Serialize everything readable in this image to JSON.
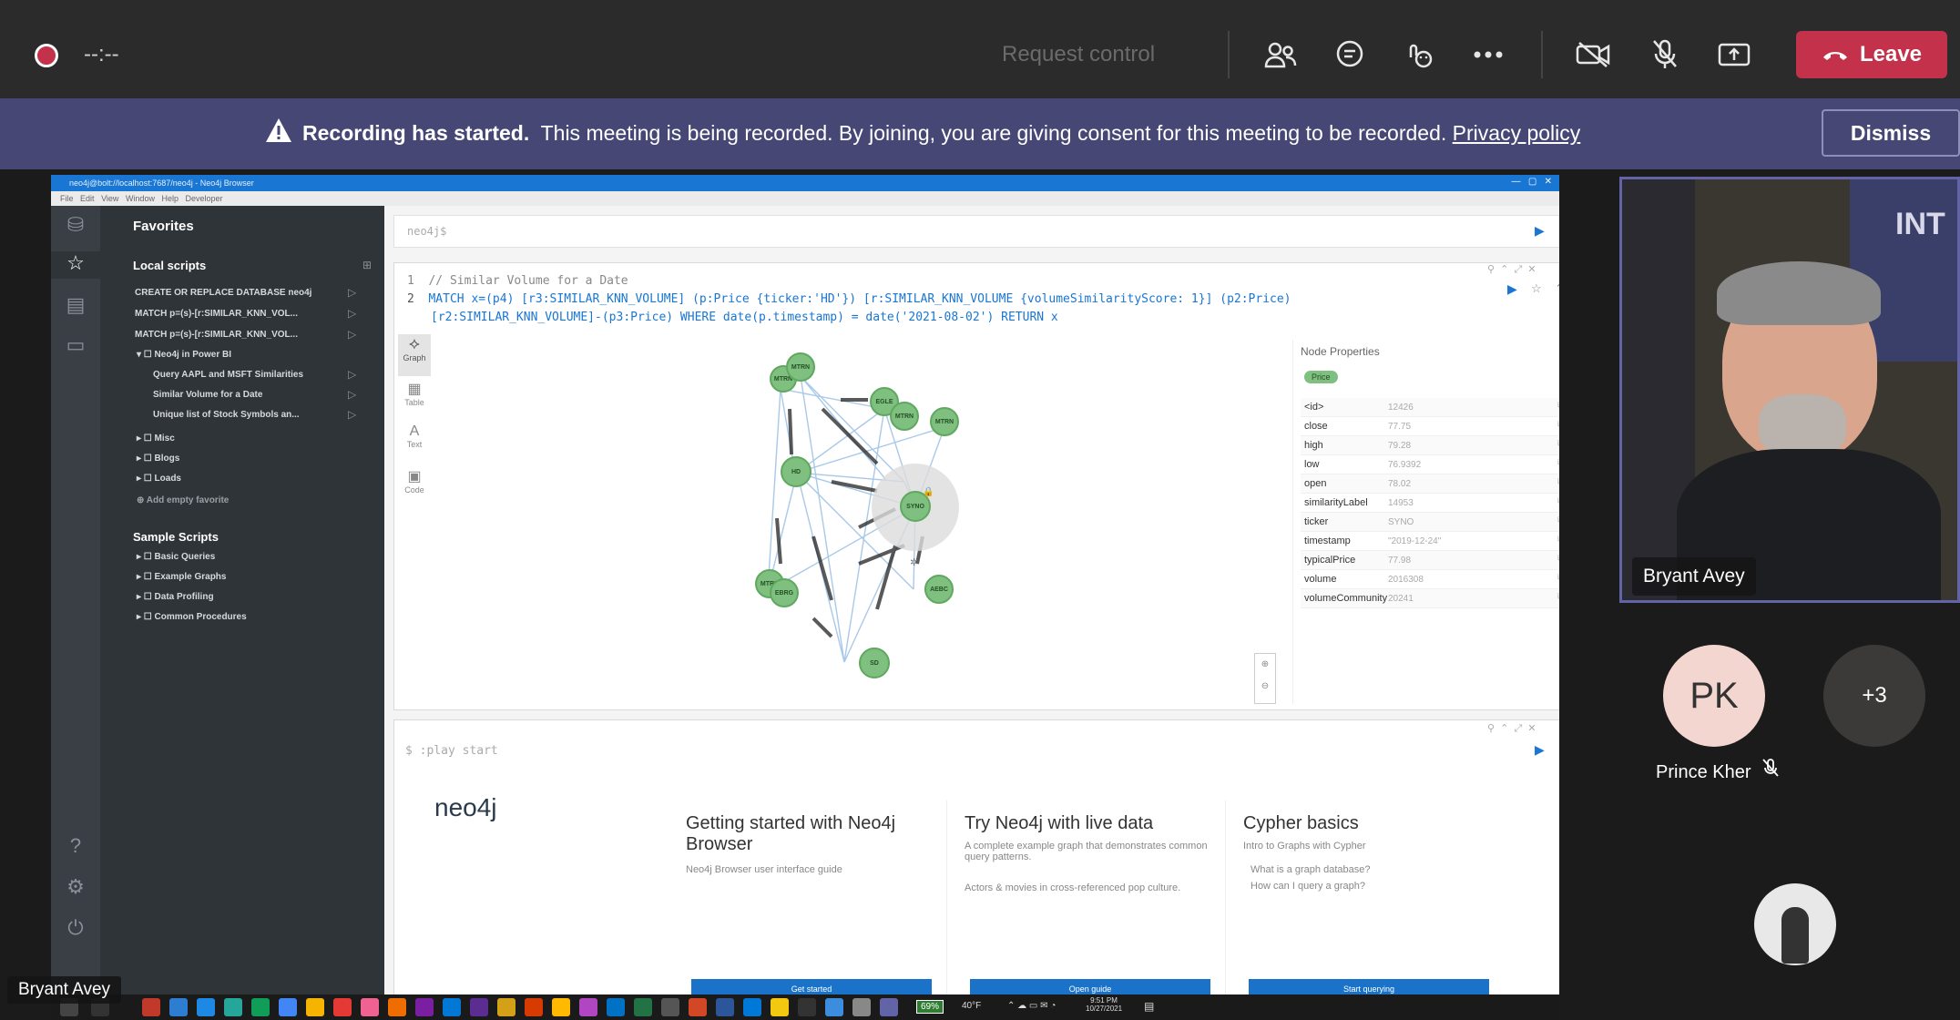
{
  "teams": {
    "timer": "--:--",
    "request_control": "Request control",
    "leave_label": "Leave",
    "icons": [
      "participants-icon",
      "chat-icon",
      "react-icon",
      "more-icon",
      "camera-off-icon",
      "mic-off-icon",
      "share-icon"
    ]
  },
  "banner": {
    "bold": "Recording has started.",
    "message": "This meeting is being recorded. By joining, you are giving consent for this meeting to be recorded.",
    "link": "Privacy policy",
    "dismiss": "Dismiss"
  },
  "neo4j": {
    "window_title": "neo4j@bolt://localhost:7687/neo4j - Neo4j Browser",
    "menus": [
      "File",
      "Edit",
      "View",
      "Window",
      "Help",
      "Developer"
    ],
    "sidebar": {
      "favorites": "Favorites",
      "local_scripts": "Local scripts",
      "items": [
        "CREATE OR REPLACE DATABASE neo4j",
        "MATCH p=(s)-[r:SIMILAR_KNN_VOL...",
        "MATCH p=(s)-[r:SIMILAR_KNN_VOL...",
        "Neo4j in Power BI",
        "Query AAPL and MSFT Similarities",
        "Similar Volume for a Date",
        "Unique list of Stock Symbols an...",
        "Misc",
        "Blogs",
        "Loads",
        "Add empty favorite"
      ],
      "sample_scripts": "Sample Scripts",
      "samples": [
        "Basic Queries",
        "Example Graphs",
        "Data Profiling",
        "Common Procedures"
      ]
    },
    "editor_prompt": "neo4j$",
    "query": {
      "line1": "// Similar Volume for a Date",
      "line2": "MATCH x=(p4) [r3:SIMILAR_KNN_VOLUME] (p:Price {ticker:'HD'}) [r:SIMILAR_KNN_VOLUME {volumeSimilarityScore: 1}] (p2:Price)",
      "line3": "[r2:SIMILAR_KNN_VOLUME]-(p3:Price) WHERE date(p.timestamp) = date('2021-08-02') RETURN x"
    },
    "view_tabs": [
      "Graph",
      "Table",
      "Text",
      "Code"
    ],
    "node_properties": {
      "title": "Node Properties",
      "label": "Price",
      "rows": [
        {
          "k": "<id>",
          "v": "12426"
        },
        {
          "k": "close",
          "v": "77.75"
        },
        {
          "k": "high",
          "v": "79.28"
        },
        {
          "k": "low",
          "v": "76.9392"
        },
        {
          "k": "open",
          "v": "78.02"
        },
        {
          "k": "similarityLabel",
          "v": "14953"
        },
        {
          "k": "ticker",
          "v": "SYNO"
        },
        {
          "k": "timestamp",
          "v": "\"2019-12-24\""
        },
        {
          "k": "typicalPrice",
          "v": "77.98"
        },
        {
          "k": "volume",
          "v": "2016308"
        },
        {
          "k": "volumeCommunity",
          "v": "20241"
        }
      ]
    },
    "graph_nodes": [
      "MTRN",
      "MTRN",
      "EGLE",
      "MTRN",
      "MTRN",
      "HD",
      "SYNO",
      "MTRN",
      "EBRG",
      "AEBC",
      "SD"
    ],
    "play_start": ":play start",
    "logo": "neo4j",
    "cards": [
      {
        "title": "Getting started with Neo4j Browser",
        "sub": "Neo4j Browser user interface guide",
        "sub2": "",
        "sub3": "",
        "btn": "Get started"
      },
      {
        "title": "Try Neo4j with live data",
        "sub": "A complete example graph that demonstrates common query patterns.",
        "sub2": "Actors & movies in cross-referenced pop culture.",
        "sub3": "",
        "btn": "Open guide"
      },
      {
        "title": "Cypher basics",
        "sub": "Intro to Graphs with Cypher",
        "sub2": "What is a graph database?",
        "sub3": "How can I query a graph?",
        "btn": "Start querying"
      }
    ]
  },
  "taskbar": {
    "battery": "69%",
    "weather": "40°F",
    "time": "9:51 PM",
    "date": "10/27/2021"
  },
  "participants": {
    "presenter_name": "Bryant Avey",
    "main_video_name": "Bryant Avey",
    "pk_initials": "PK",
    "pk_name": "Prince Kher",
    "overflow": "+3"
  }
}
